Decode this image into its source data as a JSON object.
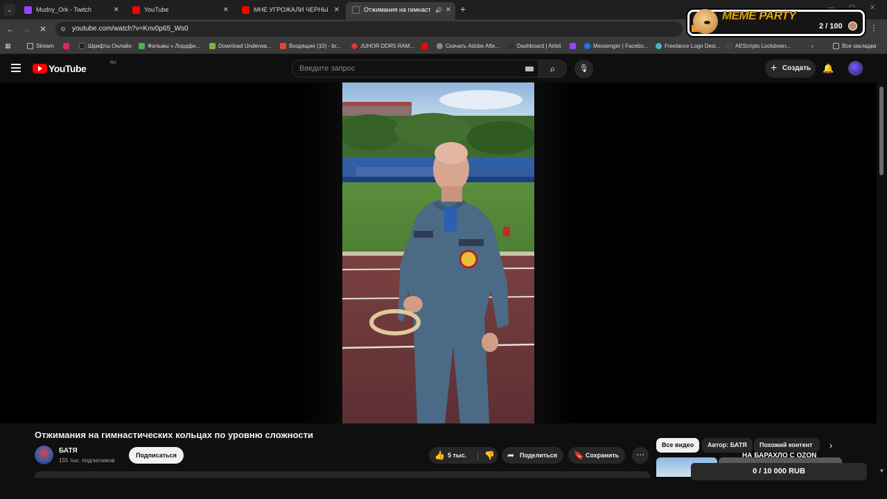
{
  "browser": {
    "tabs": [
      {
        "title": "Mudriy_Ork - Twitch",
        "favicon": "twitch-icon"
      },
      {
        "title": "YouTube",
        "favicon": "youtube-icon"
      },
      {
        "title": "МНЕ УГРОЖАЛИ ЧЕРНЫЕ ПУШ",
        "favicon": "youtube-icon"
      },
      {
        "title": "Отжимания на гимнастич",
        "favicon": "loading-icon",
        "active": true,
        "playing_audio": true
      }
    ],
    "url": "youtube.com/watch?v=Knv0p65_Ws0",
    "bookmarks": [
      "Stream",
      "Шрифты Онлайн",
      "Фильмы » Лордфи...",
      "Download Underwa...",
      "Входящие (10) - br...",
      "JUHOR DDR5 RAM...",
      "Скачать Adobe Afte...",
      "Dashboard | Airbit",
      "Messenger | Facebo...",
      "Freelance Logo Desi...",
      "AEScripts Lockdown...",
      "Все закладки"
    ]
  },
  "youtube": {
    "logo_text": "YouTube",
    "region": "RU",
    "search_placeholder": "Введите запрос",
    "create_label": "Создать"
  },
  "video": {
    "title": "Отжимания на гимнастических кольцах по уровню сложности",
    "channel": "БАТЯ",
    "subscribers": "155 тыс. подписчиков",
    "subscribe_label": "Подписаться",
    "likes": "5 тыс.",
    "share_label": "Поделиться",
    "save_label": "Сохранить"
  },
  "related_chips": [
    "Все видео",
    "Автор: БАТЯ",
    "Похожий контент"
  ],
  "overlay": {
    "meme_title": "MEME PARTY",
    "meme_counter": "2 / 100",
    "ozon_label": "НА БАРАХЛО С OZON",
    "ozon_progress": "0 / 10 000 RUB"
  },
  "colors": {
    "youtube_red": "#ff0000",
    "background": "#0f0f0f",
    "meme_gold": "#f6c318",
    "twitch_purple": "#9146ff"
  }
}
